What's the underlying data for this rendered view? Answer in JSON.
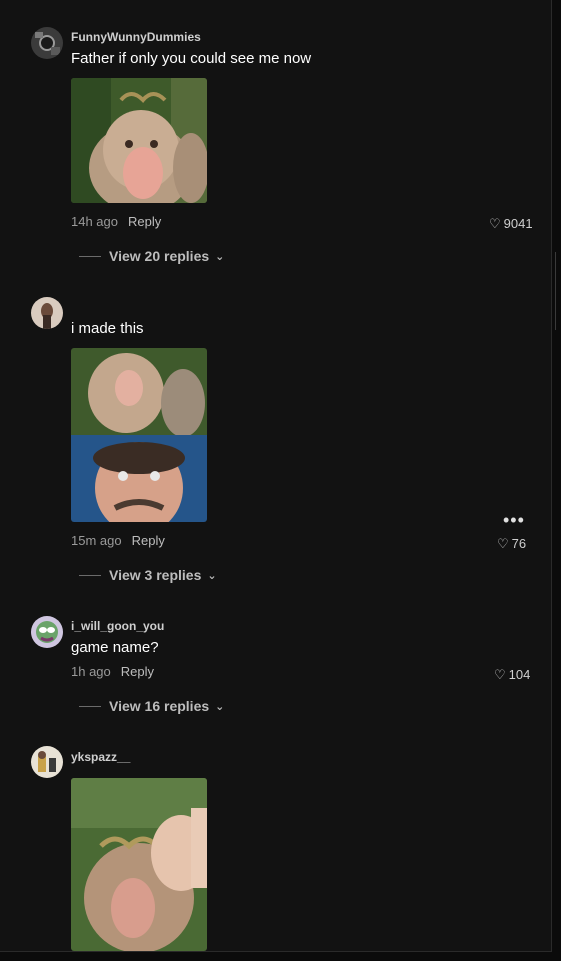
{
  "comments": [
    {
      "username": "FunnyWunnyDummies",
      "text": "Father if only you could see me now",
      "time": "14h ago",
      "reply_label": "Reply",
      "likes": "9041",
      "view_replies": "View 20 replies"
    },
    {
      "username": "",
      "text": "i made this",
      "time": "15m ago",
      "reply_label": "Reply",
      "likes": "76",
      "view_replies": "View 3 replies"
    },
    {
      "username": "i_will_goon_you",
      "text": "game name?",
      "time": "1h ago",
      "reply_label": "Reply",
      "likes": "104",
      "view_replies": "View 16 replies"
    },
    {
      "username": "ykspazz__",
      "text": "",
      "time": "",
      "reply_label": "",
      "likes": "",
      "view_replies": ""
    }
  ],
  "icons": {
    "like": "heart-outline-icon",
    "expand": "chevron-down-icon",
    "more": "more-horizontal-icon"
  },
  "colors": {
    "background": "#121212",
    "text": "#ffffff",
    "muted": "#9a9a9a"
  }
}
